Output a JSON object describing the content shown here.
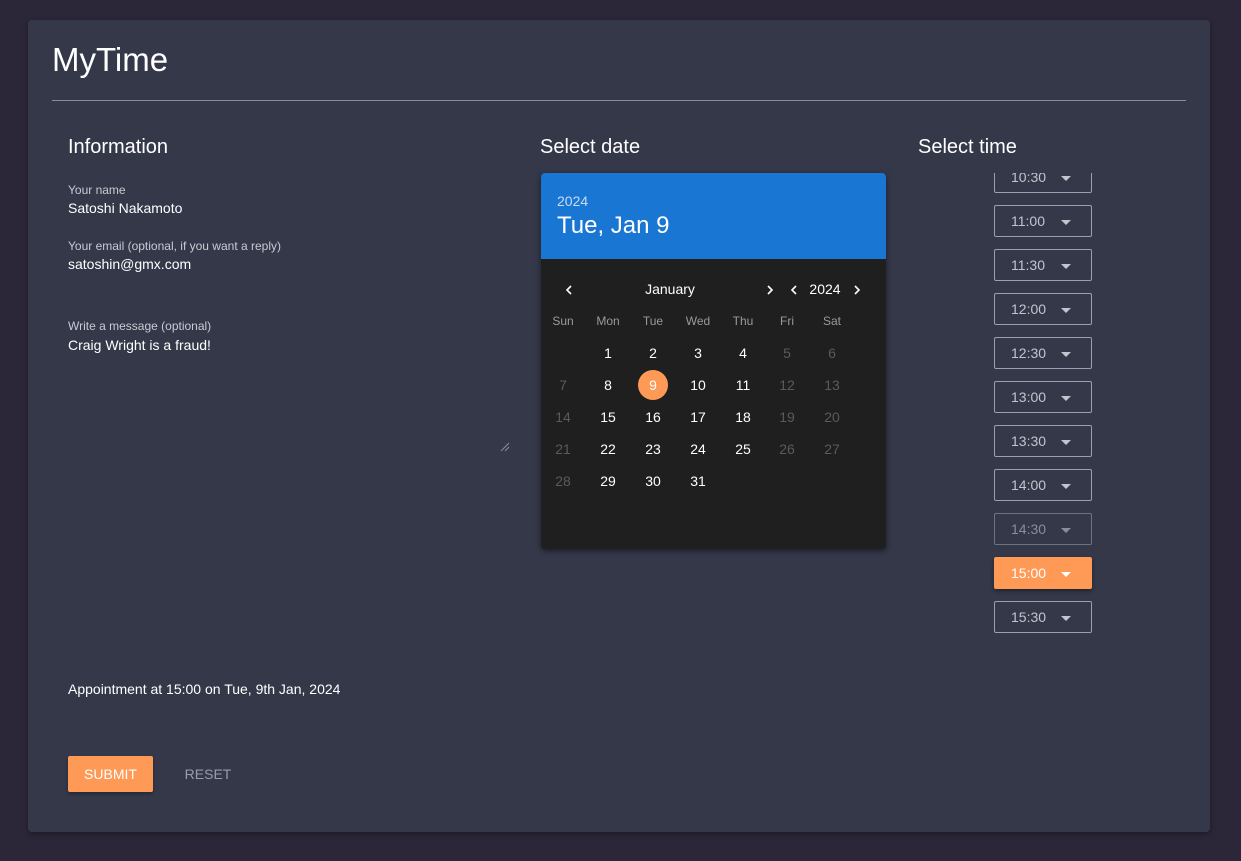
{
  "app": {
    "title": "MyTime"
  },
  "info": {
    "heading": "Information",
    "name_label": "Your name",
    "name_value": "Satoshi Nakamoto",
    "email_label": "Your email (optional, if you want a reply)",
    "email_value": "satoshin@gmx.com",
    "message_label": "Write a message (optional)",
    "message_value": "Craig Wright is a fraud!"
  },
  "date": {
    "heading": "Select date",
    "header_year": "2024",
    "header_date": "Tue, Jan 9",
    "month": "January",
    "year": "2024",
    "prev_month_icon": "chevron-left-icon",
    "next_month_icon": "chevron-right-icon",
    "weekdays": [
      "Sun",
      "Mon",
      "Tue",
      "Wed",
      "Thu",
      "Fri",
      "Sat"
    ],
    "first_weekday_index": 1,
    "days_in_month": 31,
    "selected_day": 9,
    "disabled_days": [
      5,
      6,
      7,
      12,
      13,
      14,
      19,
      20,
      21,
      26,
      27,
      28
    ],
    "colors": {
      "header": "#1976d2",
      "selected": "#ff9a56",
      "calendar_bg": "#1f1f1f"
    }
  },
  "time": {
    "heading": "Select time",
    "slots": [
      {
        "label": "10:30",
        "state": "normal"
      },
      {
        "label": "11:00",
        "state": "normal"
      },
      {
        "label": "11:30",
        "state": "normal"
      },
      {
        "label": "12:00",
        "state": "normal"
      },
      {
        "label": "12:30",
        "state": "normal"
      },
      {
        "label": "13:00",
        "state": "normal"
      },
      {
        "label": "13:30",
        "state": "normal"
      },
      {
        "label": "14:00",
        "state": "normal"
      },
      {
        "label": "14:30",
        "state": "disabled"
      },
      {
        "label": "15:00",
        "state": "selected"
      },
      {
        "label": "15:30",
        "state": "normal"
      }
    ],
    "slot_icon": "caret-down-icon"
  },
  "summary": {
    "text": "Appointment at 15:00 on Tue, 9th Jan, 2024"
  },
  "actions": {
    "submit_label": "SUBMIT",
    "reset_label": "RESET",
    "accent": "#ff9a56"
  }
}
